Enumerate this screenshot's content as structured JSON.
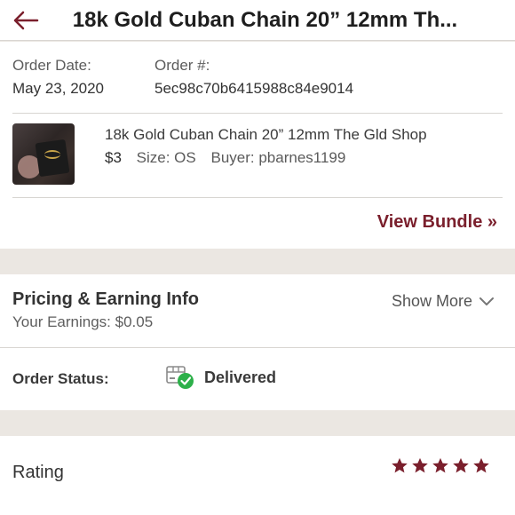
{
  "header": {
    "title": "18k Gold Cuban Chain 20” 12mm Th..."
  },
  "order": {
    "date_label": "Order Date:",
    "date_value": "May 23, 2020",
    "number_label": "Order #:",
    "number_value": "5ec98c70b6415988c84e9014"
  },
  "item": {
    "title": "18k Gold Cuban Chain 20” 12mm The Gld Shop",
    "price": "$3",
    "size": "Size: OS",
    "buyer": "Buyer: pbarnes1199"
  },
  "bundle": {
    "link_label": "View Bundle »"
  },
  "pricing": {
    "title": "Pricing & Earning Info",
    "earnings": "Your Earnings: $0.05",
    "show_more": "Show More"
  },
  "status": {
    "label": "Order Status:",
    "value": "Delivered",
    "icon": "package-delivered-icon"
  },
  "rating": {
    "label": "Rating",
    "stars": 5,
    "star_color": "#7a1f2c"
  },
  "colors": {
    "accent": "#7a1f2c",
    "delivered_check": "#2db04a",
    "background": "#ebe7e2"
  }
}
